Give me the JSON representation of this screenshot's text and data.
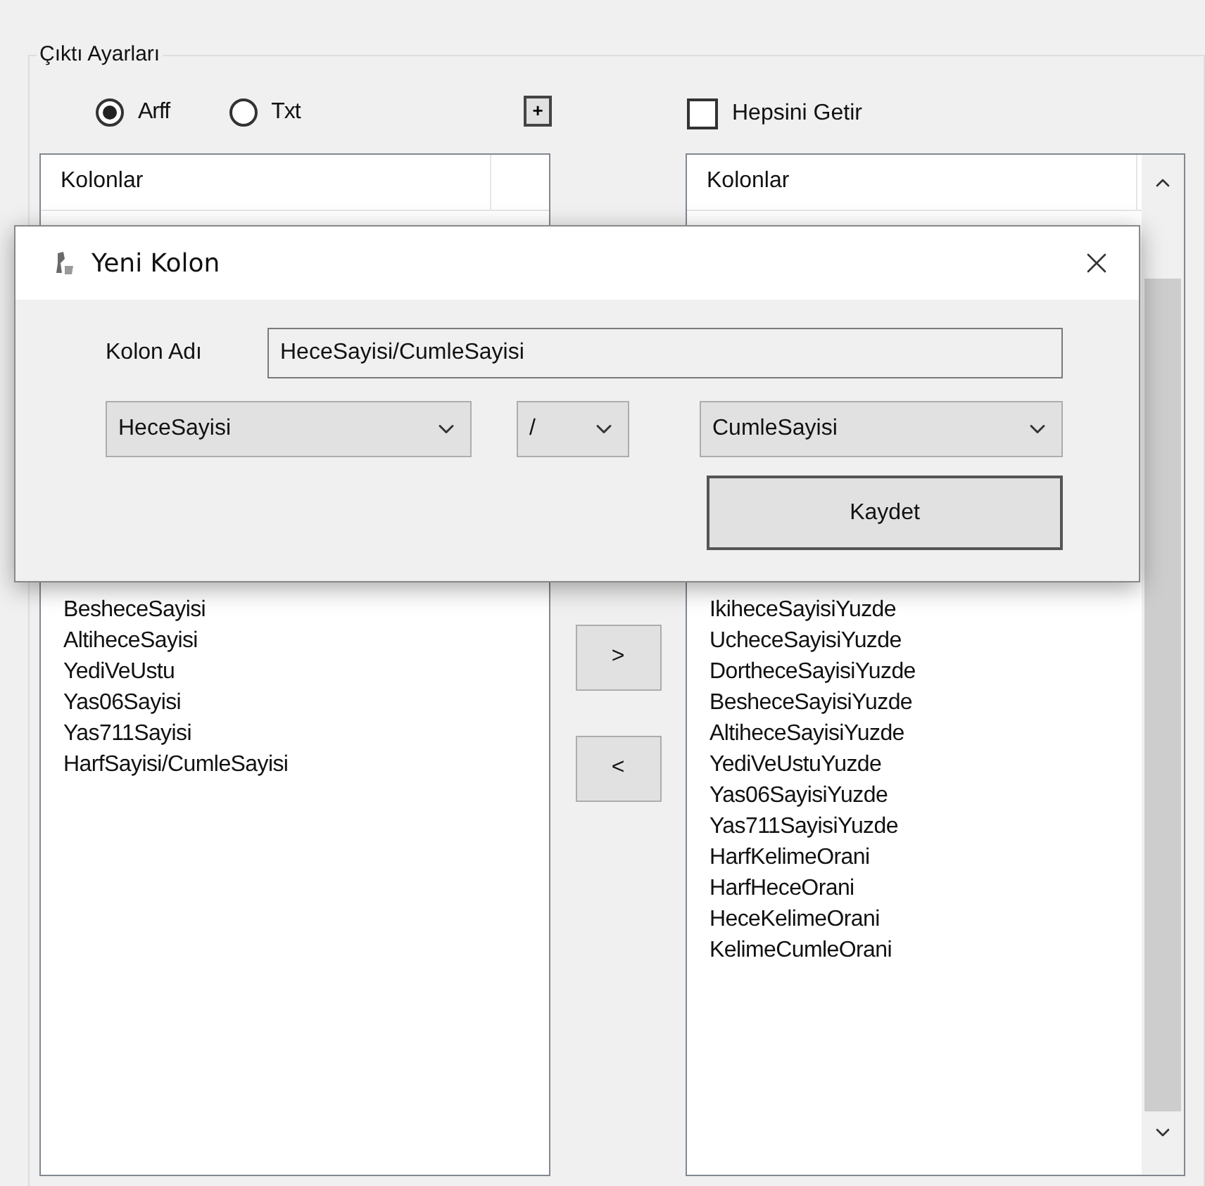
{
  "group": {
    "title": "Çıktı Ayarları"
  },
  "format_options": [
    {
      "label": "Arff",
      "selected": true
    },
    {
      "label": "Txt",
      "selected": false
    }
  ],
  "add_button": {
    "label": "+"
  },
  "select_all": {
    "label": "Hepsini Getir",
    "checked": false
  },
  "left_list": {
    "column": "Kolonlar",
    "items": [
      "BesheceSayisi",
      "AltiheceSayisi",
      "YediVeUstu",
      "Yas06Sayisi",
      "Yas711Sayisi",
      "HarfSayisi/CumleSayisi"
    ]
  },
  "move_buttons": [
    ">",
    "<"
  ],
  "right_list": {
    "column": "Kolonlar",
    "items": [
      "IkiheceSayisiYuzde",
      "UcheceSayisiYuzde",
      "DortheceSayisiYuzde",
      "BesheceSayisiYuzde",
      "AltiheceSayisiYuzde",
      "YediVeUstuYuzde",
      "Yas06SayisiYuzde",
      "Yas711SayisiYuzde",
      "HarfKelimeOrani",
      "HarfHeceOrani",
      "HeceKelimeOrani",
      "KelimeCumleOrani"
    ]
  },
  "dialog": {
    "title": "Yeni Kolon",
    "name_label": "Kolon Adı",
    "name_value": "HeceSayisi/CumleSayisi",
    "left_operand": "HeceSayisi",
    "operator": "/",
    "right_operand": "CumleSayisi",
    "save_button": "Kaydet"
  }
}
